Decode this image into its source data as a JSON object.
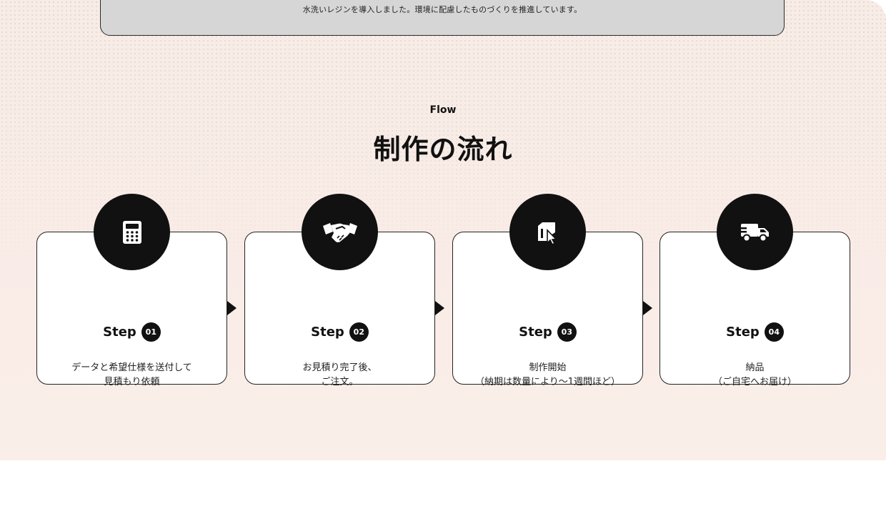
{
  "prev_card": {
    "text": "水洗いレジンを導入しました。環境に配慮したものづくりを推進しています。"
  },
  "flow": {
    "label": "Flow",
    "title": "制作の流れ",
    "steps": [
      {
        "icon": "calculator-icon",
        "word": "Step",
        "num": "01",
        "line1": "データと希望仕様を送付して",
        "line2": "見積もり依頼"
      },
      {
        "icon": "handshake-icon",
        "word": "Step",
        "num": "02",
        "line1": "お見積り完了後、",
        "line2": "ご注文。"
      },
      {
        "icon": "box-cursor-icon",
        "word": "Step",
        "num": "03",
        "line1": "制作開始",
        "line2": "（納期は数量により〜1週間ほど）"
      },
      {
        "icon": "truck-icon",
        "word": "Step",
        "num": "04",
        "line1": "納品",
        "line2": "（ご自宅へお届け）"
      }
    ]
  },
  "colors": {
    "section_bg": "#f9ece7",
    "dark": "#111111",
    "card_bg": "#ffffff"
  }
}
